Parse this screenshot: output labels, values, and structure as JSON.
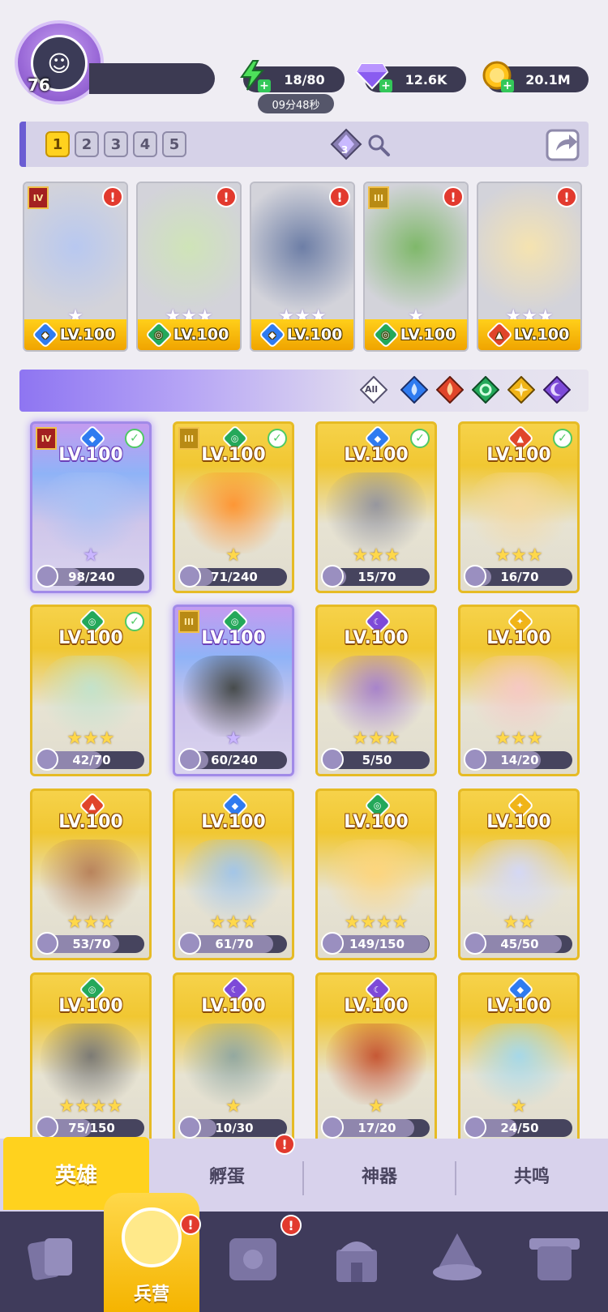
{
  "player": {
    "level": "76"
  },
  "resources": {
    "energy": "18/80",
    "energy_timer": "09分48秒",
    "gems": "12.6K",
    "gold": "20.1M"
  },
  "team_tabs": [
    "1",
    "2",
    "3",
    "4",
    "5"
  ],
  "team_gem_count": "3",
  "team_heroes": [
    {
      "level": "LV.100",
      "element": "water",
      "tier": "IV",
      "stars": "★",
      "alert": "!"
    },
    {
      "level": "LV.100",
      "element": "wind",
      "tier": "",
      "stars": "★★★",
      "alert": "!"
    },
    {
      "level": "LV.100",
      "element": "water",
      "tier": "",
      "stars": "★★★",
      "alert": "!"
    },
    {
      "level": "LV.100",
      "element": "wind",
      "tier": "III",
      "stars": "★",
      "alert": "!"
    },
    {
      "level": "LV.100",
      "element": "fire",
      "tier": "",
      "stars": "★★★",
      "alert": "!"
    }
  ],
  "filter": {
    "all_label": "All"
  },
  "heroes": [
    {
      "level": "LV.100",
      "element": "water",
      "tier": "IV",
      "checked": true,
      "purple": true,
      "stars": "★",
      "shards": "98/240",
      "progress": 0.41
    },
    {
      "level": "LV.100",
      "element": "wind",
      "tier": "III",
      "checked": true,
      "purple": false,
      "stars": "★",
      "shards": "71/240",
      "progress": 0.3
    },
    {
      "level": "LV.100",
      "element": "water",
      "tier": "",
      "checked": true,
      "purple": false,
      "stars": "★★★",
      "shards": "15/70",
      "progress": 0.21
    },
    {
      "level": "LV.100",
      "element": "fire",
      "tier": "",
      "checked": true,
      "purple": false,
      "stars": "★★★",
      "shards": "16/70",
      "progress": 0.23
    },
    {
      "level": "LV.100",
      "element": "wind",
      "tier": "",
      "checked": true,
      "purple": false,
      "stars": "★★★",
      "shards": "42/70",
      "progress": 0.6
    },
    {
      "level": "LV.100",
      "element": "wind",
      "tier": "III",
      "checked": false,
      "purple": true,
      "stars": "★",
      "shards": "60/240",
      "progress": 0.25
    },
    {
      "level": "LV.100",
      "element": "dark",
      "tier": "",
      "checked": false,
      "purple": false,
      "stars": "★★★",
      "shards": "5/50",
      "progress": 0.1
    },
    {
      "level": "LV.100",
      "element": "light",
      "tier": "",
      "checked": false,
      "purple": false,
      "stars": "★★★",
      "shards": "14/20",
      "progress": 0.7
    },
    {
      "level": "LV.100",
      "element": "fire",
      "tier": "",
      "checked": false,
      "purple": false,
      "stars": "★★★",
      "shards": "53/70",
      "progress": 0.76
    },
    {
      "level": "LV.100",
      "element": "water",
      "tier": "",
      "checked": false,
      "purple": false,
      "stars": "★★★",
      "shards": "61/70",
      "progress": 0.87
    },
    {
      "level": "LV.100",
      "element": "wind",
      "tier": "",
      "checked": false,
      "purple": false,
      "stars": "★★★★",
      "shards": "149/150",
      "progress": 0.99
    },
    {
      "level": "LV.100",
      "element": "light",
      "tier": "",
      "checked": false,
      "purple": false,
      "stars": "★★",
      "shards": "45/50",
      "progress": 0.9
    },
    {
      "level": "LV.100",
      "element": "wind",
      "tier": "",
      "checked": false,
      "purple": false,
      "stars": "★★★★",
      "shards": "75/150",
      "progress": 0.5
    },
    {
      "level": "LV.100",
      "element": "dark",
      "tier": "",
      "checked": false,
      "purple": false,
      "stars": "★",
      "shards": "10/30",
      "progress": 0.33
    },
    {
      "level": "LV.100",
      "element": "dark",
      "tier": "",
      "checked": false,
      "purple": false,
      "stars": "★",
      "shards": "17/20",
      "progress": 0.85
    },
    {
      "level": "LV.100",
      "element": "water",
      "tier": "",
      "checked": false,
      "purple": false,
      "stars": "★",
      "shards": "24/50",
      "progress": 0.48
    }
  ],
  "sub_tabs": {
    "heroes": "英雄",
    "hatch": "孵蛋",
    "artifacts": "神器",
    "resonance": "共鸣",
    "hatch_alert": "!"
  },
  "bottom_nav": {
    "barracks": "兵营",
    "barracks_alert": "!",
    "book_alert": "!"
  },
  "colors": {
    "water": "#2f7bf0",
    "wind": "#24a85a",
    "fire": "#e0452a",
    "light": "#f0b418",
    "dark": "#7d4ad8"
  }
}
